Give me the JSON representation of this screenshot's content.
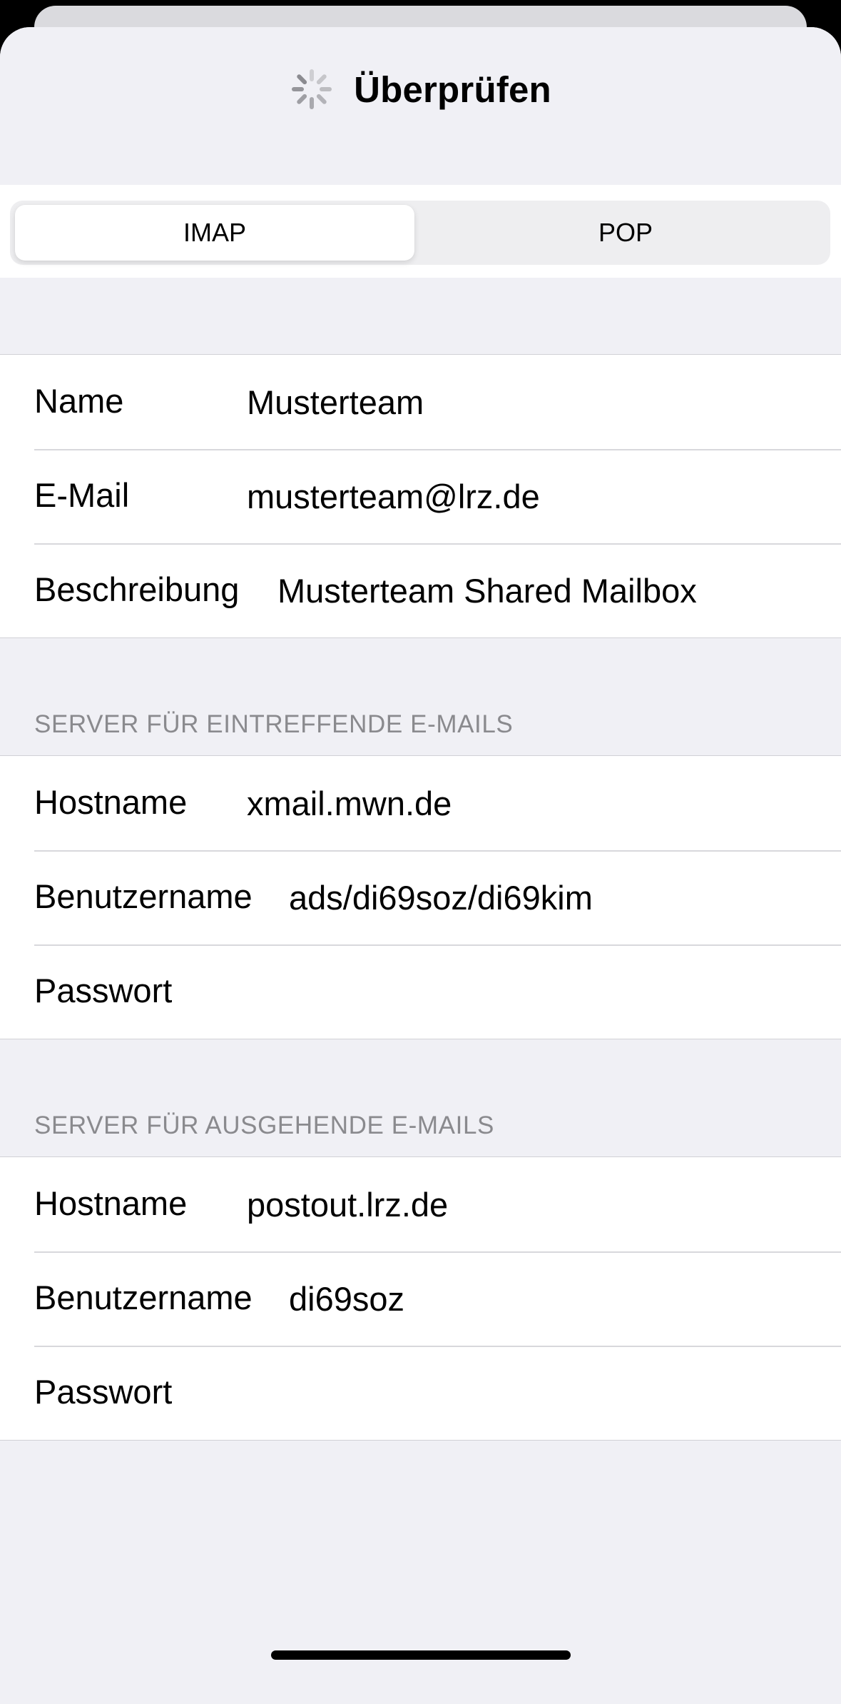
{
  "nav": {
    "title": "Überprüfen",
    "spinner_icon": "activity-spinner-icon"
  },
  "segmented": {
    "options": [
      "IMAP",
      "POP"
    ],
    "selected": "IMAP"
  },
  "account": {
    "rows": [
      {
        "label": "Name",
        "value": "Musterteam"
      },
      {
        "label": "E-Mail",
        "value": "musterteam@lrz.de"
      },
      {
        "label": "Beschreibung",
        "value": "Musterteam Shared Mailbox"
      }
    ]
  },
  "incoming": {
    "header": "SERVER FÜR EINTREFFENDE E-MAILS",
    "rows": [
      {
        "label": "Hostname",
        "value": "xmail.mwn.de"
      },
      {
        "label": "Benutzername",
        "value": "ads/di69soz/di69kim"
      },
      {
        "label": "Passwort",
        "value": ""
      }
    ]
  },
  "outgoing": {
    "header": "SERVER FÜR AUSGEHENDE E-MAILS",
    "rows": [
      {
        "label": "Hostname",
        "value": "postout.lrz.de"
      },
      {
        "label": "Benutzername",
        "value": "di69soz"
      },
      {
        "label": "Passwort",
        "value": ""
      }
    ]
  },
  "colors": {
    "background": "#f0f0f5",
    "cell": "#ffffff",
    "section_header": "#8a8a8e",
    "separator": "#d1d1d6"
  }
}
